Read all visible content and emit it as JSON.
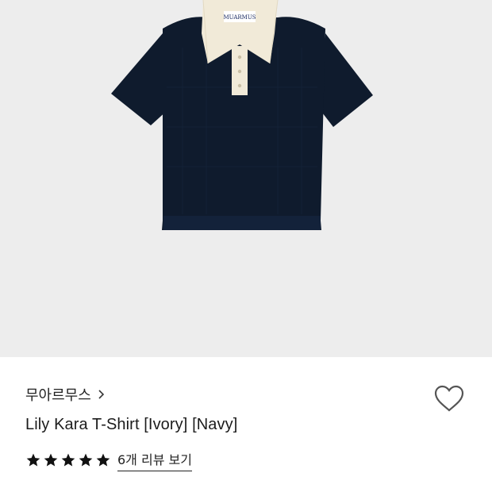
{
  "product": {
    "brand": "무아르무스",
    "name": "Lily Kara T-Shirt [Ivory] [Navy]",
    "rating": 5,
    "reviews_link": "6개 리뷰 보기",
    "label_text": "MUARMUS"
  },
  "colors": {
    "hero_bg": "#ededed",
    "shirt": "#0f1b2d",
    "collar": "#f1ead8",
    "star": "#111111",
    "heart_stroke": "#555555"
  },
  "icons": {
    "brand_chevron": "chevron-right-icon",
    "wishlist": "heart-outline-icon",
    "star": "star-filled-icon"
  }
}
